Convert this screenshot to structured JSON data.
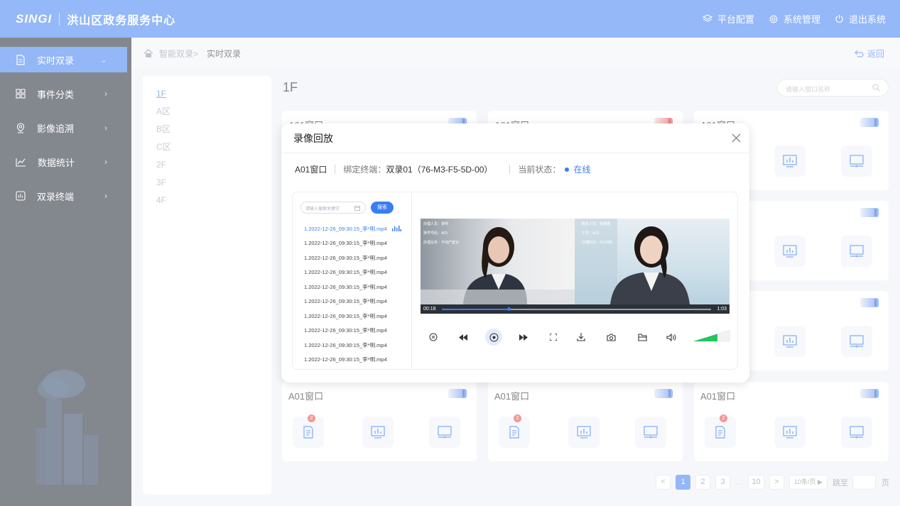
{
  "header": {
    "logo": "SINGI",
    "title": "洪山区政务服务中心",
    "actions": [
      {
        "label": "平台配置",
        "icon": "layers-icon"
      },
      {
        "label": "系统管理",
        "icon": "gear-icon"
      },
      {
        "label": "退出系统",
        "icon": "power-icon"
      }
    ]
  },
  "sidebar": {
    "items": [
      {
        "label": "实时双录",
        "icon": "document-icon",
        "active": true
      },
      {
        "label": "事件分类",
        "icon": "grid-icon"
      },
      {
        "label": "影像追溯",
        "icon": "location-icon"
      },
      {
        "label": "数据统计",
        "icon": "line-chart-icon"
      },
      {
        "label": "双录终端",
        "icon": "terminal-icon"
      }
    ]
  },
  "breadcrumb": {
    "parent": "智能双录>",
    "current": "实时双录",
    "back": "返回"
  },
  "floors": [
    "1F",
    "A区",
    "B区",
    "C区",
    "2F",
    "3F",
    "4F"
  ],
  "main": {
    "title": "1F",
    "search_placeholder": "请输入窗口名称"
  },
  "cards": {
    "title": "A01窗口",
    "badge": "2"
  },
  "pagination": {
    "prev": "<",
    "pages": [
      "1",
      "2",
      "3"
    ],
    "dots": "…",
    "last": "10",
    "next": ">",
    "size": "10条/页 ▶",
    "jump_label": "跳至",
    "page_unit": "页"
  },
  "modal": {
    "title": "录像回放",
    "window": "A01窗口",
    "terminal_label": "绑定终端：",
    "terminal_value": "双录01（76-M3-F5-5D-00）",
    "status_label": "当前状态：",
    "status_value": "在线",
    "search_placeholder": "请输入搜索关键字",
    "search_button": "搜索",
    "files": [
      "1.2022-12-26_09:30:15_李*明.mp4",
      "1.2022-12-26_09:30:15_李*明.mp4",
      "1.2022-12-26_09:30:15_李*明.mp4",
      "1.2022-12-26_09:30:15_李*明.mp4",
      "1.2022-12-26_09:30:15_李*明.mp4",
      "1.2022-12-26_09:30:15_李*明.mp4",
      "1.2022-12-26_09:30:15_李*明.mp4",
      "1.2022-12-26_09:30:15_李*明.mp4",
      "1.2022-12-26_09:30:15_李*明.mp4",
      "1.2022-12-26_09:30:15_李*明.mp4"
    ],
    "video": {
      "left_info": [
        "办理人员：李明",
        "排号号码：A03",
        "办理业务：不动产登记"
      ],
      "right_info": [
        "服务人员：张珊珊",
        "工号：A03",
        "办理时长：5分30秒"
      ],
      "current_time": "00:18",
      "total_time": "1:03",
      "progress": 0.25
    }
  },
  "colors": {
    "primary": "#3b7cf0",
    "sidebar": "#1e2532",
    "badge": "#e8453c",
    "volume": "#22c55e"
  }
}
